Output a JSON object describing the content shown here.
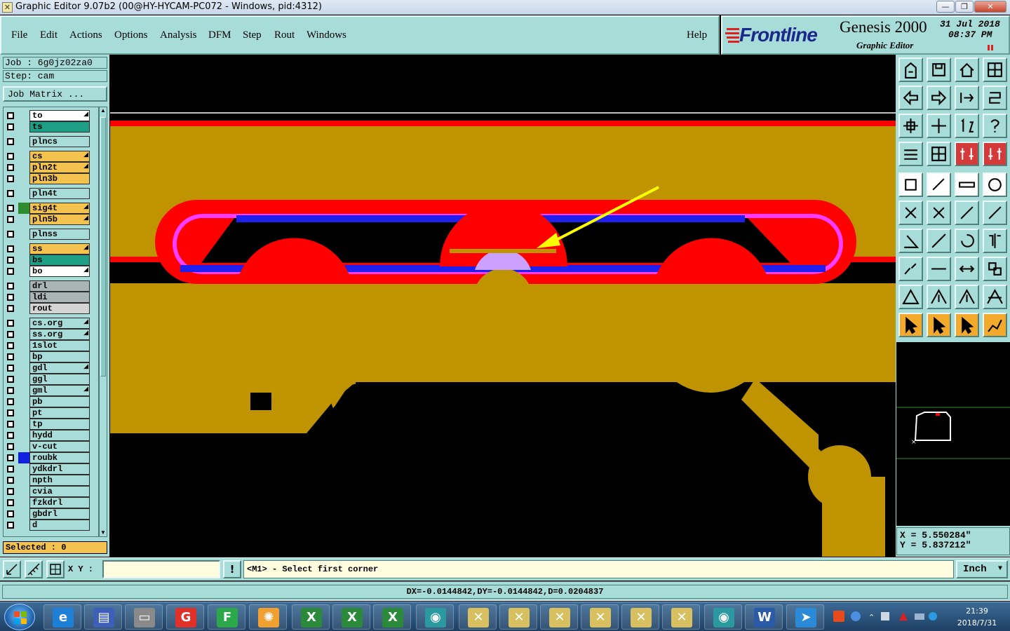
{
  "window": {
    "title": "Graphic Editor 9.07b2 (00@HY-HYCAM-PC072 - Windows, pid:4312)",
    "minimize": "—",
    "restore": "❐",
    "close": "✕"
  },
  "menu": {
    "file": "File",
    "edit": "Edit",
    "actions": "Actions",
    "options": "Options",
    "analysis": "Analysis",
    "dfm": "DFM",
    "step": "Step",
    "rout": "Rout",
    "windows": "Windows",
    "help": "Help"
  },
  "logo": {
    "brand": "Frontline",
    "product": "Genesis 2000",
    "subtitle": "Graphic Editor",
    "date": "31 Jul 2018",
    "time": "08:37 PM"
  },
  "job": {
    "job_label": "Job : 6g0jz02za0",
    "step_label": "Step: cam",
    "matrix_button": "Job Matrix ..."
  },
  "layers": [
    {
      "name": "to",
      "color": "#ffffff",
      "swatch": "",
      "arrow": true
    },
    {
      "name": "ts",
      "color": "#1f9e86",
      "swatch": "",
      "arrow": false
    },
    {
      "name": "plncs",
      "color": "#a8dcd8",
      "swatch": "",
      "arrow": false
    },
    {
      "name": "cs",
      "color": "#f4c24e",
      "swatch": "",
      "arrow": true
    },
    {
      "name": "pln2t",
      "color": "#f4c24e",
      "swatch": "",
      "arrow": true
    },
    {
      "name": "pln3b",
      "color": "#f4c24e",
      "swatch": "",
      "arrow": false
    },
    {
      "name": "pln4t",
      "color": "#a8dcd8",
      "swatch": "",
      "arrow": false
    },
    {
      "name": "sig4t",
      "color": "#f4c24e",
      "swatch": "#2e8b2e",
      "arrow": true
    },
    {
      "name": "pln5b",
      "color": "#f4c24e",
      "swatch": "",
      "arrow": true
    },
    {
      "name": "plnss",
      "color": "#a8dcd8",
      "swatch": "",
      "arrow": false
    },
    {
      "name": "ss",
      "color": "#f4c24e",
      "swatch": "",
      "arrow": true
    },
    {
      "name": "bs",
      "color": "#1f9e86",
      "swatch": "",
      "arrow": false
    },
    {
      "name": "bo",
      "color": "#ffffff",
      "swatch": "",
      "arrow": true
    },
    {
      "name": "drl",
      "color": "#a9b4b4",
      "swatch": "",
      "arrow": false
    },
    {
      "name": "ldi",
      "color": "#a9b4b4",
      "swatch": "",
      "arrow": false
    },
    {
      "name": "rout",
      "color": "#d4d4d4",
      "swatch": "",
      "arrow": false
    },
    {
      "name": "cs.org",
      "color": "#a8dcd8",
      "swatch": "",
      "arrow": true
    },
    {
      "name": "ss.org",
      "color": "#a8dcd8",
      "swatch": "",
      "arrow": true
    },
    {
      "name": "1slot",
      "color": "#a8dcd8",
      "swatch": "",
      "arrow": false
    },
    {
      "name": "bp",
      "color": "#a8dcd8",
      "swatch": "",
      "arrow": false
    },
    {
      "name": "gdl",
      "color": "#a8dcd8",
      "swatch": "",
      "arrow": true
    },
    {
      "name": "ggl",
      "color": "#a8dcd8",
      "swatch": "",
      "arrow": false
    },
    {
      "name": "gml",
      "color": "#a8dcd8",
      "swatch": "",
      "arrow": true
    },
    {
      "name": "pb",
      "color": "#a8dcd8",
      "swatch": "",
      "arrow": false
    },
    {
      "name": "pt",
      "color": "#a8dcd8",
      "swatch": "",
      "arrow": false
    },
    {
      "name": "tp",
      "color": "#a8dcd8",
      "swatch": "",
      "arrow": false
    },
    {
      "name": "hydd",
      "color": "#a8dcd8",
      "swatch": "",
      "arrow": false
    },
    {
      "name": "v-cut",
      "color": "#a8dcd8",
      "swatch": "",
      "arrow": false
    },
    {
      "name": "roubk",
      "color": "#a8dcd8",
      "swatch": "#1020e0",
      "arrow": false
    },
    {
      "name": "ydkdrl",
      "color": "#a8dcd8",
      "swatch": "",
      "arrow": false
    },
    {
      "name": "npth",
      "color": "#a8dcd8",
      "swatch": "",
      "arrow": false
    },
    {
      "name": "cvia",
      "color": "#a8dcd8",
      "swatch": "",
      "arrow": false
    },
    {
      "name": "fzkdrl",
      "color": "#a8dcd8",
      "swatch": "",
      "arrow": false
    },
    {
      "name": "gbdrl",
      "color": "#a8dcd8",
      "swatch": "",
      "arrow": false
    },
    {
      "name": "d",
      "color": "#a8dcd8",
      "swatch": "",
      "arrow": false
    }
  ],
  "selected_label": "Selected : 0",
  "coords": {
    "x": "X = 5.550284\"",
    "y": "Y = 5.837212\""
  },
  "command": {
    "xy_label": "X Y :",
    "xy_value": "",
    "prompt": "<M1> - Select first corner",
    "unit": "Inch",
    "unit_arrow": "▼"
  },
  "measure": "DX=-0.0144842,DY=-0.0144842,D=0.0204837",
  "taskbar": {
    "clock_time": "21:39",
    "clock_date": "2018/7/31"
  },
  "colors": {
    "panel": "#a8dcd8",
    "copper": "#bf9400",
    "red": "#ff0000",
    "blue": "#1f1ff0",
    "magenta": "#ff3cff",
    "arrow": "#ffff00"
  }
}
